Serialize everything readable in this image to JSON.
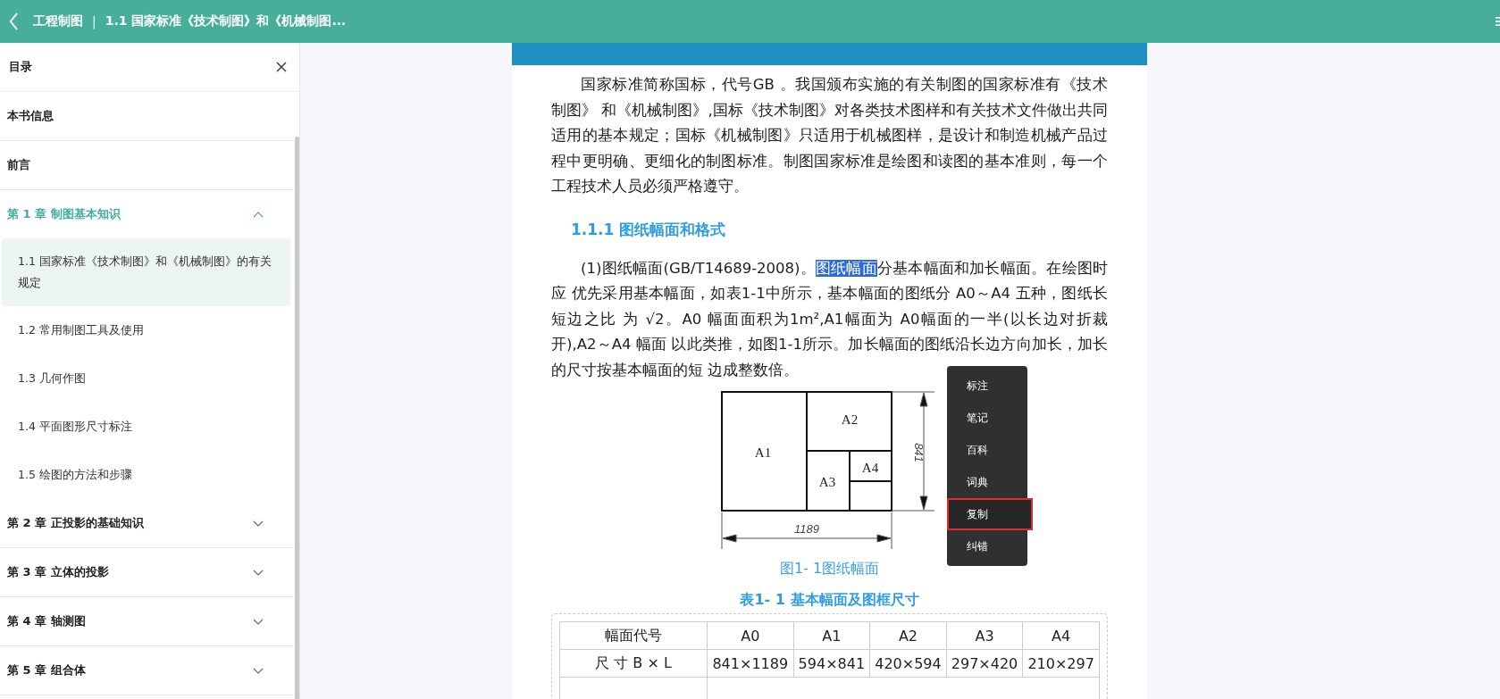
{
  "top_bar": {
    "book_title": "工程制图",
    "separator": "|",
    "chapter_title": "1.1 国家标准《技术制图》和《机械制图..."
  },
  "sidebar": {
    "title": "目录",
    "items": [
      {
        "label": "本书信息",
        "kind": "section"
      },
      {
        "label": "前言",
        "kind": "section"
      },
      {
        "label": "第 1 章 制图基本知识",
        "kind": "chapter",
        "expanded": true,
        "children": [
          {
            "label": "1.1 国家标准《技术制图》和《机械制图》的有关规定",
            "selected": true
          },
          {
            "label": "1.2 常用制图工具及使用",
            "selected": false
          },
          {
            "label": "1.3 几何作图",
            "selected": false
          },
          {
            "label": "1.4 平面图形尺寸标注",
            "selected": false
          },
          {
            "label": "1.5 绘图的方法和步骤",
            "selected": false
          }
        ]
      },
      {
        "label": "第 2 章 正投影的基础知识",
        "kind": "chapter",
        "expanded": false
      },
      {
        "label": "第 3 章 立体的投影",
        "kind": "chapter",
        "expanded": false
      },
      {
        "label": "第 4 章 轴测图",
        "kind": "chapter",
        "expanded": false
      },
      {
        "label": "第 5 章 组合体",
        "kind": "chapter",
        "expanded": false
      }
    ]
  },
  "content": {
    "intro": "国家标准简称国标，代号GB 。我国颁布实施的有关制图的国家标准有《技术制图》 和《机械制图》,国标《技术制图》对各类技术图样和有关技术文件做出共同适用的基本规定；国标《机械制图》只适用于机械图样，是设计和制造机械产品过程中更明确、更细化的制图标准。制图国家标准是绘图和读图的基本准则，每一个工程技术人员必须严格遵守。",
    "heading": "1.1.1  图纸幅面和格式",
    "paragraph": [
      {
        "text": "(1)图纸幅面(GB/T14689-2008)。",
        "selected": false
      },
      {
        "text": "图纸幅面",
        "selected": true
      },
      {
        "text": "分基本幅面和加长幅面。在绘图时应 优先采用基本幅面，如表1-1中所示，基本幅面的图纸分 A0～A4  五种，图纸长短边之比 为 √2。A0 幅面面积为1m²,A1幅面为 A0幅面的一半(以长边对折裁开),A2～A4  幅面 以此类推，如图1-1所示。加长幅面的图纸沿长边方向加长，加长的尺寸按基本幅面的短 边成整数倍。",
        "selected": false
      }
    ],
    "figure": {
      "labels": [
        "A1",
        "A2",
        "A3",
        "A4"
      ],
      "height_dim": "841",
      "width_dim": "1189",
      "caption": "图1- 1图纸幅面"
    },
    "table_title": "表1- 1  基本幅面及图框尺寸",
    "table": {
      "columns": [
        "幅面代号",
        "A0",
        "A1",
        "A2",
        "A3",
        "A4"
      ],
      "rows": [
        [
          "尺 寸 B × L",
          "841×1189",
          "594×841",
          "420×594",
          "297×420",
          "210×297"
        ]
      ]
    }
  },
  "context_menu": {
    "items": [
      {
        "label": "标注",
        "selected": false
      },
      {
        "label": "笔记",
        "selected": false
      },
      {
        "label": "百科",
        "selected": false
      },
      {
        "label": "词典",
        "selected": false
      },
      {
        "label": "复制",
        "selected": true
      },
      {
        "label": "纠错",
        "selected": false
      }
    ]
  }
}
